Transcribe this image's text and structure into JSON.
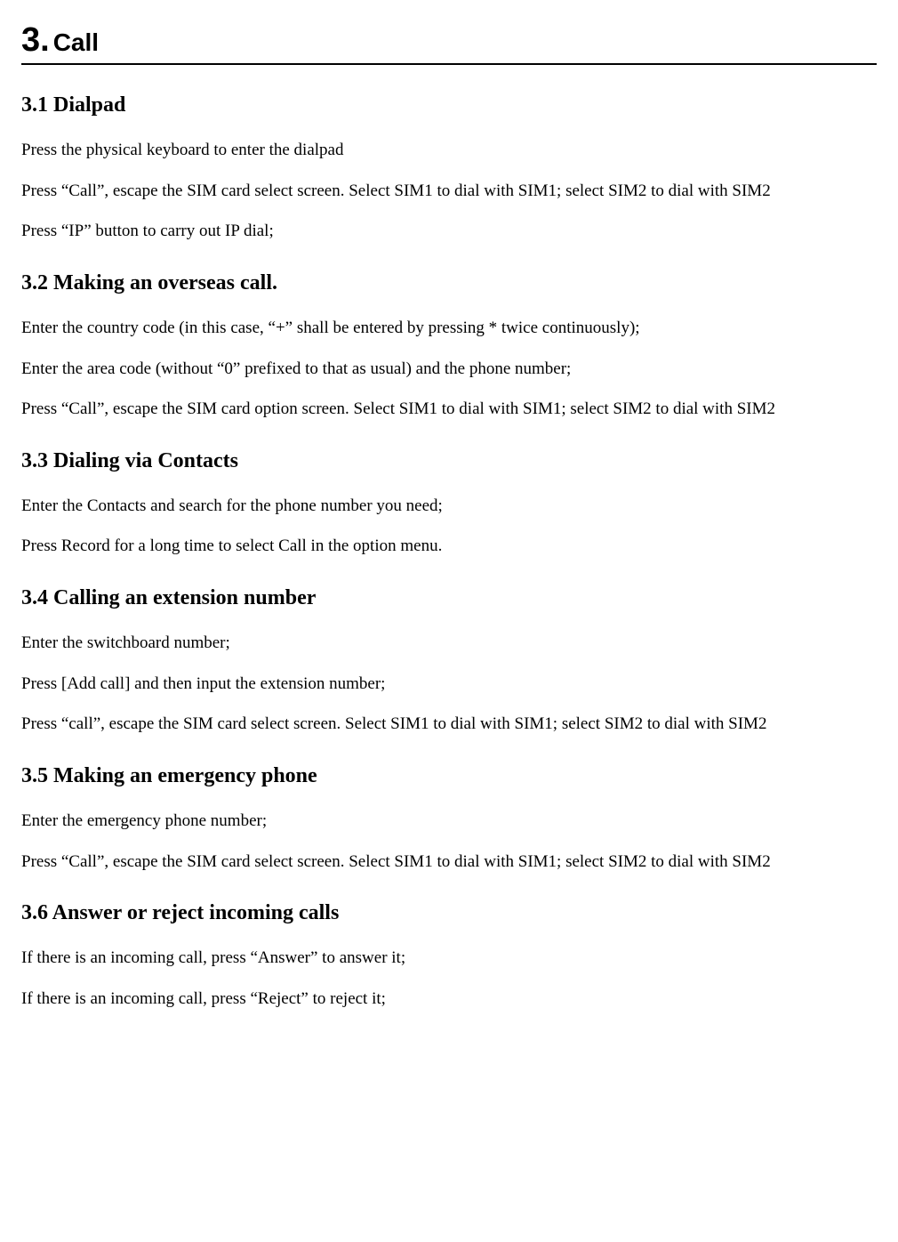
{
  "chapter": {
    "num": "3.",
    "word": "Call"
  },
  "sections": {
    "s1": {
      "h": "3.1 Dialpad",
      "p1": "Press the physical keyboard to enter the dialpad",
      "p2": "Press “Call”, escape the SIM card select screen. Select SIM1 to dial with SIM1; select SIM2 to dial with SIM2",
      "p3": "Press “IP” button to carry out IP dial;"
    },
    "s2": {
      "h": "3.2 Making an overseas call.",
      "p1": "Enter the country code (in this case, “+” shall be entered by pressing * twice continuously);",
      "p2": "Enter the area code (without “0” prefixed to that as usual) and the phone number;",
      "p3": "Press “Call”, escape the SIM card option screen. Select SIM1 to dial with SIM1; select SIM2 to dial with SIM2"
    },
    "s3": {
      "h": "3.3 Dialing via Contacts",
      "p1": "Enter the Contacts and search for the phone number you need;",
      "p2": "Press Record for a long time to select Call in the option menu."
    },
    "s4": {
      "h": "3.4 Calling an extension number",
      "p1": "Enter the switchboard number;",
      "p2": "Press [Add call] and then input the extension number;",
      "p3": "Press “call”, escape the SIM card select screen. Select SIM1 to dial with SIM1; select SIM2 to dial with SIM2"
    },
    "s5": {
      "h": "3.5 Making an emergency phone",
      "p1": "Enter the emergency phone number;",
      "p2": "Press “Call”, escape the SIM card select screen. Select SIM1 to dial with SIM1; select SIM2 to dial with SIM2"
    },
    "s6": {
      "h": "3.6 Answer or reject incoming calls",
      "p1": "If there is an incoming call, press “Answer” to answer it;",
      "p2": "If there is an incoming call, press “Reject” to reject it;"
    }
  }
}
